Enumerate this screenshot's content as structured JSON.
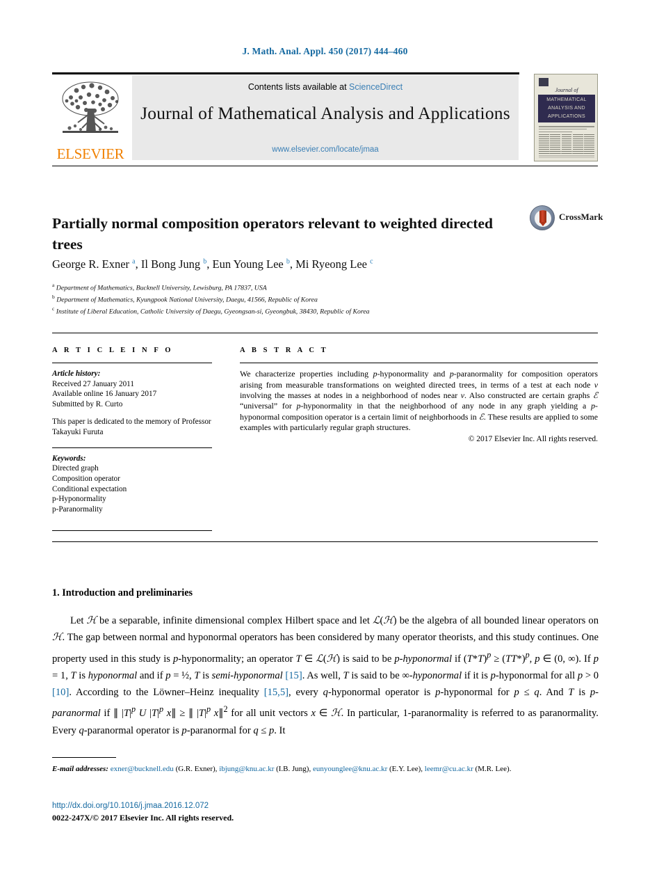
{
  "running_head": "J. Math. Anal. Appl. 450 (2017) 444–460",
  "masthead": {
    "contents_prefix": "Contents lists available at",
    "sciencedirect": "ScienceDirect",
    "journal_title": "Journal of Mathematical Analysis and Applications",
    "journal_url": "www.elsevier.com/locate/jmaa",
    "publisher": "ELSEVIER",
    "cover": {
      "journal_of": "Journal of",
      "band_line1": "MATHEMATICAL",
      "band_line2": "ANALYSIS AND",
      "band_line3": "APPLICATIONS"
    }
  },
  "article": {
    "title": "Partially normal composition operators relevant to weighted directed trees",
    "crossmark_label": "CrossMark",
    "authors_html": "George R. Exner <sup>a</sup>, Il Bong Jung <sup>b</sup>, Eun Young Lee <sup>b</sup>, Mi Ryeong Lee <sup>c</sup>",
    "affiliations": [
      {
        "mark": "a",
        "text": "Department of Mathematics, Bucknell University, Lewisburg, PA 17837, USA"
      },
      {
        "mark": "b",
        "text": "Department of Mathematics, Kyungpook National University, Daegu, 41566, Republic of Korea"
      },
      {
        "mark": "c",
        "text": "Institute of Liberal Education, Catholic University of Daegu, Gyeongsan-si, Gyeongbuk, 38430, Republic of Korea"
      }
    ]
  },
  "info": {
    "heading": "A R T I C L E    I N F O",
    "history_label": "Article history:",
    "history": [
      "Received 27 January 2011",
      "Available online 16 January 2017",
      "Submitted by R. Curto"
    ],
    "dedication": "This paper is dedicated to the memory of Professor Takayuki Furuta",
    "keywords_label": "Keywords:",
    "keywords": [
      "Directed graph",
      "Composition operator",
      "Conditional expectation",
      "p-Hyponormality",
      "p-Paranormality"
    ]
  },
  "abstract": {
    "heading": "A B S T R A C T",
    "text_html": "We characterize properties including <i>p</i>-hyponormality and <i>p</i>-paranormality for composition operators arising from measurable transformations on weighted directed trees, in terms of a test at each node <i>v</i> involving the masses at nodes in a neighborhood of nodes near <i>v</i>. Also constructed are certain graphs <span class=\"cal\">&#8496;</span> “universal” for <i>p</i>-hyponormality in that the neighborhood of any node in any graph yielding a <i>p</i>-hyponormal composition operator is a certain limit of neighborhoods in <span class=\"cal\">&#8496;</span>. These results are applied to some examples with particularly regular graph structures.",
    "copyright": "© 2017 Elsevier Inc. All rights reserved."
  },
  "body": {
    "section_heading": "1.  Introduction and preliminaries",
    "paragraph_html": "Let <span class=\"cal\">&#8459;</span> be a separable, infinite dimensional complex Hilbert space and let <span class=\"cal\">&#8466;</span>(<span class=\"cal\">&#8459;</span>) be the algebra of all bounded linear operators on <span class=\"cal\">&#8459;</span>. The gap between normal and hyponormal operators has been considered by many operator theorists, and this study continues. One property used in this study is <i>p</i>-hyponormality; an operator <i>T</i> &#8712; <span class=\"cal\">&#8466;</span>(<span class=\"cal\">&#8459;</span>) is said to be <i>p-hyponormal</i> if (<i>T</i>*<i>T</i>)<sup><i>p</i></sup> &#8805; (<i>TT</i>*)<sup><i>p</i></sup>, <i>p</i> &#8712; (0, &#8734;). If <i>p</i> = 1, <i>T</i> is <i>hyponormal</i> and if <i>p</i> = &#189;, <i>T</i> is <i>semi-hyponormal</i> <span class=\"ref\">[15]</span>. As well, <i>T</i> is said to be &#8734;-<i>hyponormal</i> if it is <i>p</i>-hyponormal for all <i>p</i> &gt; 0 <span class=\"ref\">[10]</span>. According to the Löwner–Heinz inequality <span class=\"ref\">[15,5]</span>, every <i>q</i>-hyponormal operator is <i>p</i>-hyponormal for <i>p</i> &#8804; <i>q</i>. And <i>T</i> is <i>p-paranormal</i> if &#8741; |<i>T</i>|<sup><i>p</i></sup> <i>U</i> |<i>T</i>|<sup><i>p</i></sup> <i>x</i>&#8741; &#8805; &#8741; |<i>T</i>|<sup><i>p</i></sup> <i>x</i>&#8741;<sup>2</sup> for all unit vectors <i>x</i> &#8712; <span class=\"cal\">&#8459;</span>. In particular, 1-paranormality is referred to as paranormality. Every <i>q</i>-paranormal operator is <i>p</i>-paranormal for <i>q</i> &#8804; <i>p</i>. It"
  },
  "footnote": {
    "emails_label": "E-mail addresses:",
    "emails_html": "<a href=\"#\">exner@bucknell.edu</a> (G.R. Exner), <a href=\"#\">ibjung@knu.ac.kr</a> (I.B. Jung), <a href=\"#\">eunyounglee@knu.ac.kr</a> (E.Y. Lee), <a href=\"#\">leemr@cu.ac.kr</a> (M.R. Lee).",
    "doi": "http://dx.doi.org/10.1016/j.jmaa.2016.12.072",
    "issn": "0022-247X/© 2017 Elsevier Inc. All rights reserved."
  },
  "colors": {
    "link": "#1368a0",
    "accent_orange": "#f08000",
    "band_gray": "#e9e9e9",
    "cover_navy": "#2f2b4f"
  }
}
